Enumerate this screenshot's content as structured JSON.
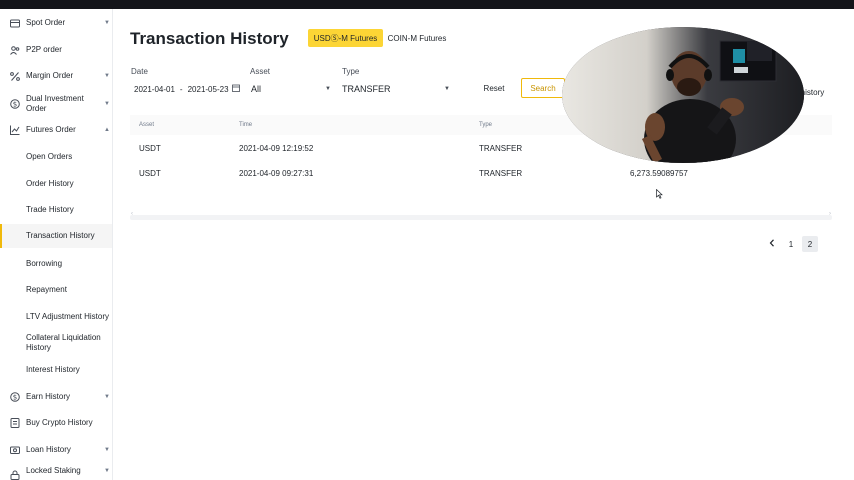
{
  "sidebar": {
    "items": [
      {
        "label": "Spot Order",
        "icon": "wallet-icon",
        "expandable": true
      },
      {
        "label": "P2P order",
        "icon": "users-icon",
        "expandable": false
      },
      {
        "label": "Margin Order",
        "icon": "percent-icon",
        "expandable": true
      },
      {
        "label": "Dual Investment Order",
        "icon": "coin-icon",
        "expandable": true
      },
      {
        "label": "Futures Order",
        "icon": "chart-icon",
        "expandable": true,
        "expanded": true
      },
      {
        "label": "Open Orders",
        "sub": true
      },
      {
        "label": "Order History",
        "sub": true
      },
      {
        "label": "Trade History",
        "sub": true
      },
      {
        "label": "Transaction History",
        "sub": true,
        "active": true
      },
      {
        "label": "Borrowing",
        "sub": true
      },
      {
        "label": "Repayment",
        "sub": true
      },
      {
        "label": "LTV Adjustment History",
        "sub": true
      },
      {
        "label": "Collateral Liquidation History",
        "sub": true
      },
      {
        "label": "Interest History",
        "sub": true
      },
      {
        "label": "Earn History",
        "icon": "coin-icon",
        "expandable": true
      },
      {
        "label": "Buy Crypto History",
        "icon": "card-icon",
        "expandable": false
      },
      {
        "label": "Loan History",
        "icon": "loan-icon",
        "expandable": true
      },
      {
        "label": "Locked Staking",
        "icon": "lock-icon",
        "expandable": true
      }
    ]
  },
  "header": {
    "title": "Transaction History",
    "tabs": [
      {
        "label": "USDⓈ-M Futures",
        "active": true
      },
      {
        "label": "COIN-M Futures",
        "active": false
      }
    ]
  },
  "filters": {
    "date_label": "Date",
    "date_from": "2021-04-01",
    "date_sep": "-",
    "date_to": "2021-05-23",
    "asset_label": "Asset",
    "asset_value": "All",
    "type_label": "Type",
    "type_value": "TRANSFER",
    "reset_label": "Reset",
    "search_label": "Search",
    "history_link": "n history"
  },
  "table": {
    "columns": [
      "Asset",
      "Time",
      "Type"
    ],
    "rows": [
      {
        "asset": "USDT",
        "time": "2021-04-09 12:19:52",
        "type": "TRANSFER",
        "amount": ""
      },
      {
        "asset": "USDT",
        "time": "2021-04-09 09:27:31",
        "type": "TRANSFER",
        "amount": "6,273.59089757"
      }
    ]
  },
  "pagination": {
    "pages": [
      "1",
      "2"
    ],
    "current": "2"
  },
  "colors": {
    "accent": "#fcd535",
    "accent_border": "#f0b90b",
    "text": "#1e2329",
    "muted": "#707a8a"
  }
}
